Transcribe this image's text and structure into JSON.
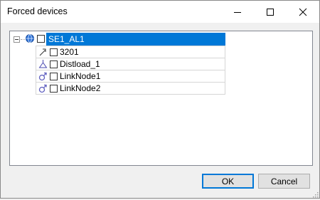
{
  "window": {
    "title": "Forced devices"
  },
  "tree": {
    "root": {
      "label": "SE1_AL1",
      "checked": false,
      "expanded": true,
      "selected": true,
      "icon": "globe-icon"
    },
    "children": [
      {
        "label": "3201",
        "checked": false,
        "icon": "arrow-line-icon"
      },
      {
        "label": "Distload_1",
        "checked": false,
        "icon": "load-triangle-icon"
      },
      {
        "label": "LinkNode1",
        "checked": false,
        "icon": "link-node-icon"
      },
      {
        "label": "LinkNode2",
        "checked": false,
        "icon": "link-node-icon"
      }
    ]
  },
  "buttons": {
    "ok_label": "OK",
    "cancel_label": "Cancel"
  },
  "colors": {
    "selection": "#0078d7",
    "link_icon": "#6060c0",
    "globe_icon": "#2a6fd6"
  }
}
